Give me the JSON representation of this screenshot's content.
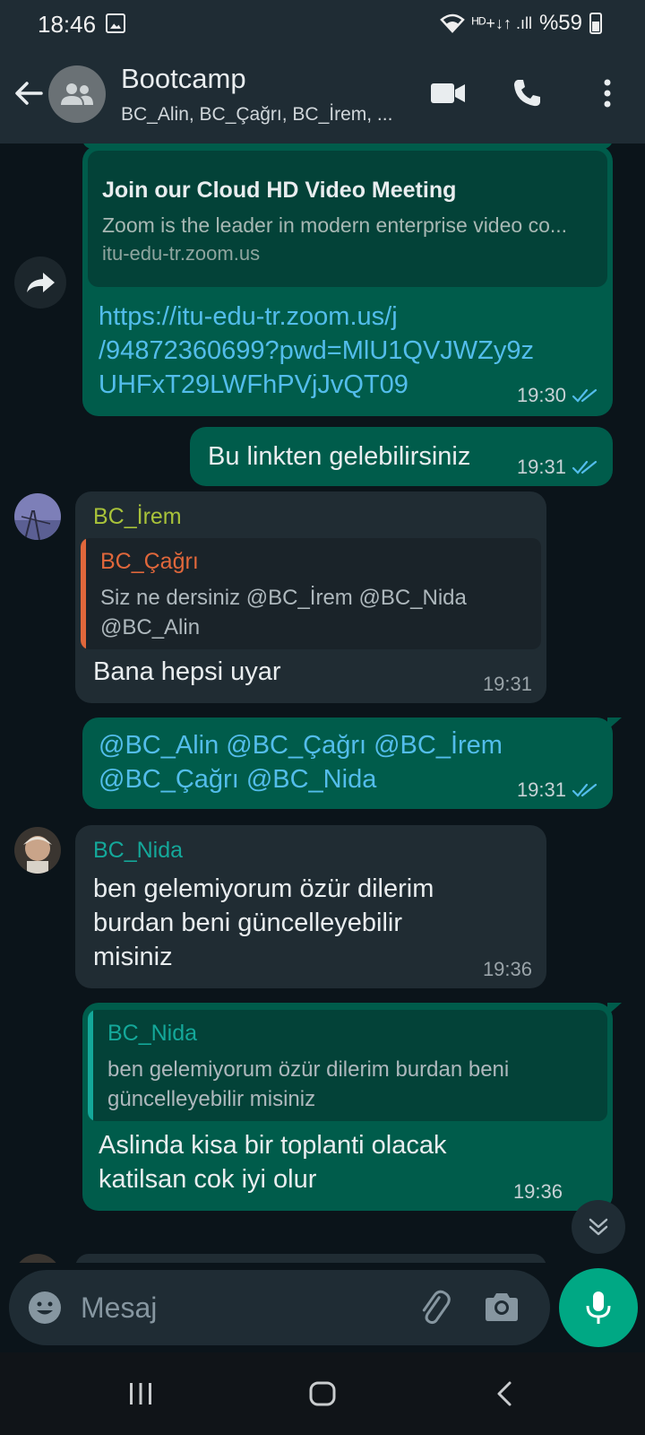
{
  "status_bar": {
    "time": "18:46",
    "indicators": "ᴴᴰ+↓↑ .ıll",
    "battery": "%59"
  },
  "header": {
    "title": "Bootcamp",
    "subtitle": "BC_Alin, BC_Çağrı, BC_İrem, ..."
  },
  "messages": {
    "m1": {
      "link_title": "Join our Cloud HD Video Meeting",
      "link_desc": "Zoom is the leader in modern enterprise video co...",
      "link_domain": "itu-edu-tr.zoom.us",
      "url_line1": "https://itu-edu-tr.zoom.us/j",
      "url_line2": "/94872360699?pwd=MlU1QVJWZy9z",
      "url_line3": "UHFxT29LWFhPVjJvQT09",
      "time": "19:30"
    },
    "m2": {
      "text": "Bu linkten gelebilirsiniz",
      "time": "19:31"
    },
    "m3": {
      "sender": "BC_İrem",
      "quote_sender": "BC_Çağrı",
      "quote_line1": "Siz ne dersiniz @BC_İrem @BC_Nida",
      "quote_line2": "@BC_Alin",
      "text": "Bana hepsi uyar",
      "time": "19:31"
    },
    "m4": {
      "line1": "@BC_Alin @BC_Çağrı @BC_İrem",
      "line2": "@BC_Çağrı @BC_Nida",
      "time": "19:31"
    },
    "m5": {
      "sender": "BC_Nida",
      "line1": "ben gelemiyorum özür dilerim",
      "line2": "burdan beni güncelleyebilir",
      "line3": "misiniz",
      "time": "19:36"
    },
    "m6": {
      "quote_sender": "BC_Nida",
      "quote_line1": "ben gelemiyorum özür dilerim burdan beni",
      "quote_line2": "güncelleyebilir misiniz",
      "line1": "Aslinda kisa bir toplanti olacak",
      "line2": "katilsan cok iyi olur",
      "time": "19:36"
    }
  },
  "composer": {
    "placeholder": "Mesaj"
  },
  "colors": {
    "outgoing_bubble": "#005c4b",
    "incoming_bubble": "#202c33",
    "accent": "#00a884",
    "link": "#53bdeb",
    "irem_name": "#a8c23a",
    "cagri_name": "#e0673b",
    "nida_name": "#14a89a"
  }
}
